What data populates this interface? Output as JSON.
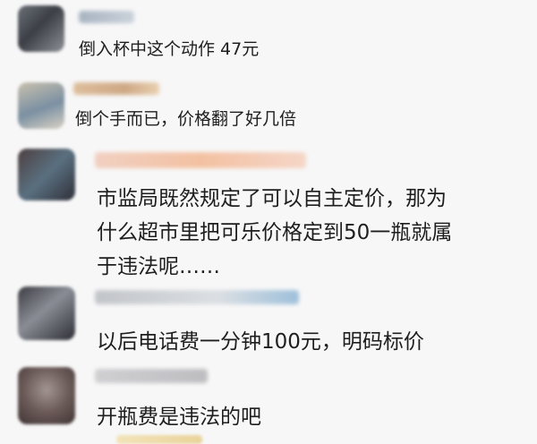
{
  "comments": [
    {
      "text": "倒入杯中这个动作 47元"
    },
    {
      "text": "倒个手而已，价格翻了好几倍"
    },
    {
      "lines": [
        "市监局既然规定了可以自主定价，那为",
        "什么超市里把可乐价格定到50一瓶就属",
        "于违法呢……"
      ]
    },
    {
      "text": "以后电话费一分钟100元，明码标价"
    },
    {
      "text": "开瓶费是违法的吧"
    }
  ]
}
